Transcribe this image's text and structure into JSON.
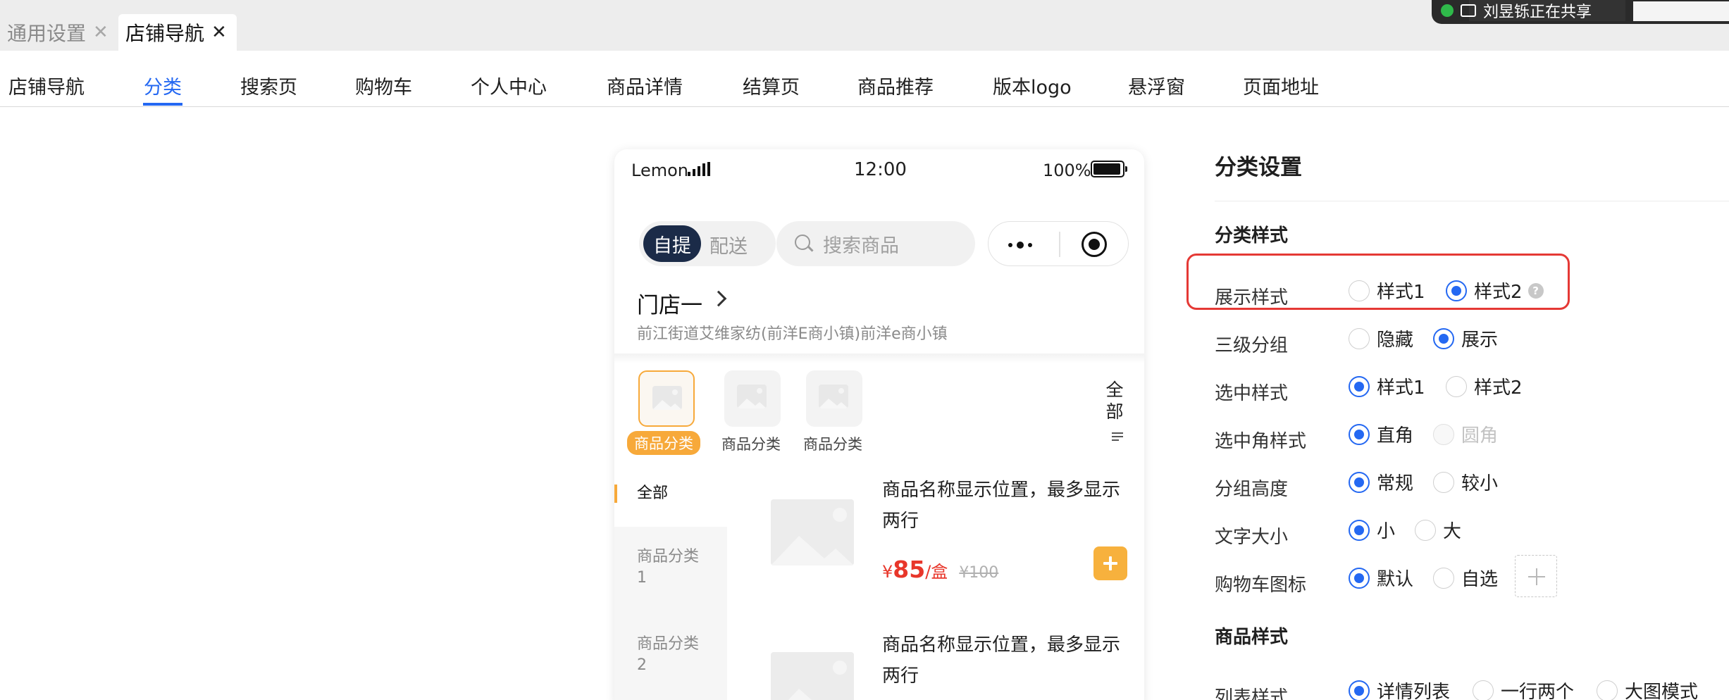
{
  "tabs": [
    {
      "label": "通用设置",
      "active": false
    },
    {
      "label": "店铺导航",
      "active": true
    }
  ],
  "sharing": {
    "text": "刘昱铄正在共享"
  },
  "nav": {
    "items": [
      "店铺导航",
      "分类",
      "搜索页",
      "购物车",
      "个人中心",
      "商品详情",
      "结算页",
      "商品推荐",
      "版本logo",
      "悬浮窗",
      "页面地址"
    ],
    "active_index": 1
  },
  "preview": {
    "status": {
      "carrier": "Lemon",
      "time": "12:00",
      "battery": "100%"
    },
    "mode_on": "自提",
    "mode_off": "配送",
    "search_placeholder": "搜索商品",
    "store_name": "门店一",
    "store_address": "前江街道艾维家纺(前洋E商小镇)前洋e商小镇",
    "categories": [
      "商品分类",
      "商品分类",
      "商品分类"
    ],
    "all_label": "全部",
    "side_items": [
      "全部",
      "商品分类1",
      "商品分类2"
    ],
    "goods": [
      {
        "name": "商品名称显示位置，最多显示两行",
        "currency": "¥",
        "price": "85",
        "unit": "/盒",
        "original": "¥100"
      },
      {
        "name": "商品名称显示位置，最多显示两行"
      }
    ]
  },
  "settings": {
    "title": "分类设置",
    "section_category": "分类样式",
    "section_goods": "商品样式",
    "rows": [
      {
        "label": "展示样式",
        "options": [
          "样式1",
          "样式2"
        ],
        "selected": 1,
        "help": "?"
      },
      {
        "label": "三级分组",
        "options": [
          "隐藏",
          "展示"
        ],
        "selected": 1
      },
      {
        "label": "选中样式",
        "options": [
          "样式1",
          "样式2"
        ],
        "selected": 0
      },
      {
        "label": "选中角样式",
        "options": [
          "直角",
          "圆角"
        ],
        "selected": 0,
        "disabled": [
          1
        ]
      },
      {
        "label": "分组高度",
        "options": [
          "常规",
          "较小"
        ],
        "selected": 0
      },
      {
        "label": "文字大小",
        "options": [
          "小",
          "大"
        ],
        "selected": 0
      },
      {
        "label": "购物车图标",
        "options": [
          "默认",
          "自选"
        ],
        "selected": 0
      },
      {
        "label": "列表样式",
        "options": [
          "详情列表",
          "一行两个",
          "大图模式"
        ],
        "selected": 0
      }
    ]
  },
  "colors": {
    "accent": "#2468f2",
    "orange": "#f7a93a",
    "price": "#e8362a",
    "highlight": "#e53935"
  }
}
